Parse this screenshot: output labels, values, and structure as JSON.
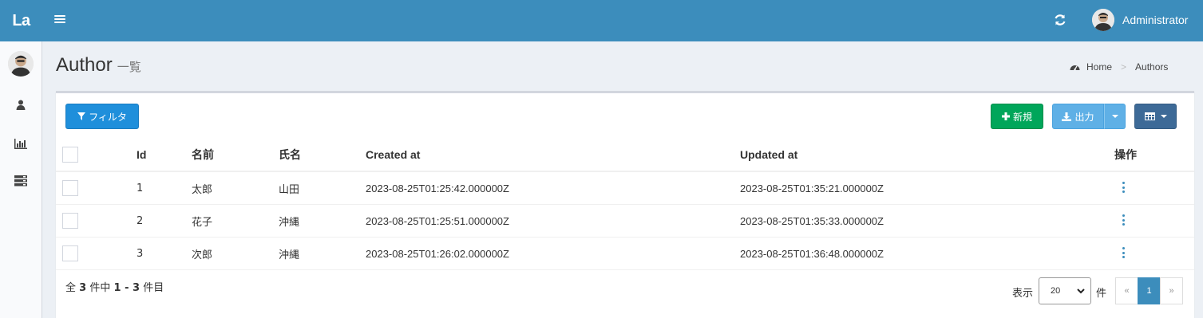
{
  "app": {
    "logo": "La"
  },
  "header": {
    "user_name": "Administrator"
  },
  "page": {
    "title": "Author",
    "subtitle": "一覧"
  },
  "breadcrumb": {
    "home": "Home",
    "current": "Authors"
  },
  "toolbar": {
    "filter_label": "フィルタ",
    "new_label": "新規",
    "export_label": "出力"
  },
  "table": {
    "headers": {
      "id": "Id",
      "name": "名前",
      "full_name": "氏名",
      "created_at": "Created at",
      "updated_at": "Updated at",
      "actions": "操作"
    },
    "rows": [
      {
        "id": "1",
        "name": "太郎",
        "full_name": "山田",
        "created_at": "2023-08-25T01:25:42.000000Z",
        "updated_at": "2023-08-25T01:35:21.000000Z"
      },
      {
        "id": "2",
        "name": "花子",
        "full_name": "沖縄",
        "created_at": "2023-08-25T01:25:51.000000Z",
        "updated_at": "2023-08-25T01:35:33.000000Z"
      },
      {
        "id": "3",
        "name": "次郎",
        "full_name": "沖縄",
        "created_at": "2023-08-25T01:26:02.000000Z",
        "updated_at": "2023-08-25T01:36:48.000000Z"
      }
    ]
  },
  "pagination": {
    "summary_prefix": "全",
    "total": "3",
    "summary_mid": "件中",
    "range": "1 - 3",
    "summary_suffix": "件目",
    "per_page_label": "表示",
    "per_page_value": "20",
    "per_page_unit": "件",
    "prev": "«",
    "current_page": "1",
    "next": "»"
  },
  "colors": {
    "header": "#3c8dbc",
    "filter_button": "#1f8fdb",
    "new_button": "#00a65a",
    "export_button": "#5fb0e6",
    "columns_button": "#3d6a97"
  },
  "icons": [
    "hamburger-icon",
    "refresh-icon",
    "user-icon",
    "bar-chart-icon",
    "server-icon",
    "dashboard-icon",
    "filter-icon",
    "plus-icon",
    "download-icon",
    "table-icon",
    "kebab-icon"
  ]
}
